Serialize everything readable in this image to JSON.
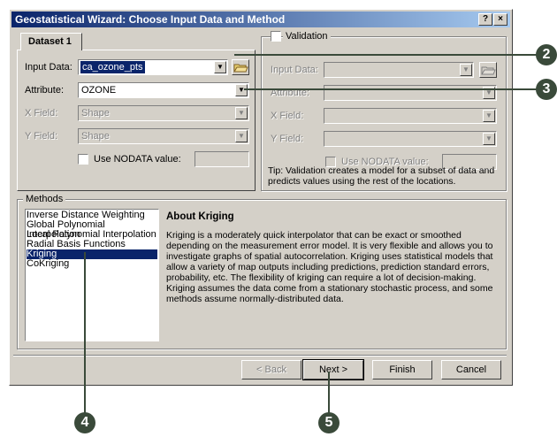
{
  "window": {
    "title": "Geostatistical Wizard: Choose Input Data and Method",
    "help_glyph": "?",
    "close_glyph": "×"
  },
  "dataset": {
    "tab_label": "Dataset 1",
    "input_label": "Input Data:",
    "input_value": "ca_ozone_pts",
    "attribute_label": "Attribute:",
    "attribute_value": "OZONE",
    "xfield_label": "X Field:",
    "xfield_value": "Shape",
    "yfield_label": "Y Field:",
    "yfield_value": "Shape",
    "nodata_label": "Use NODATA value:"
  },
  "validation": {
    "label": "Validation",
    "input_label": "Input Data:",
    "attribute_label": "Attribute:",
    "xfield_label": "X Field:",
    "yfield_label": "Y Field:",
    "nodata_label": "Use NODATA value:",
    "tip": "Tip:  Validation creates a model for a subset of data and predicts values using the rest of the locations."
  },
  "methods": {
    "label": "Methods",
    "items": [
      "Inverse Distance Weighting",
      "Global Polynomial Interpolation",
      "Local Polynomial Interpolation",
      "Radial Basis Functions",
      "Kriging",
      "CoKriging"
    ],
    "selected": "Kriging"
  },
  "about": {
    "title": "About Kriging",
    "text": "Kriging is a moderately quick interpolator that can be exact or smoothed depending on the measurement error model. It is very flexible and allows you to investigate graphs of spatial autocorrelation. Kriging uses statistical models that allow a variety of map outputs including predictions, prediction standard errors, probability, etc. The flexibility of kriging can require a lot of decision-making. Kriging assumes the data come from a stationary stochastic process, and some methods assume normally-distributed data."
  },
  "buttons": {
    "back": "< Back",
    "next": "Next >",
    "finish": "Finish",
    "cancel": "Cancel"
  },
  "callouts": [
    "2",
    "3",
    "4",
    "5"
  ],
  "colors": {
    "callout": "#3a4a3a",
    "title_start": "#0a246a",
    "selection": "#0a246a"
  }
}
